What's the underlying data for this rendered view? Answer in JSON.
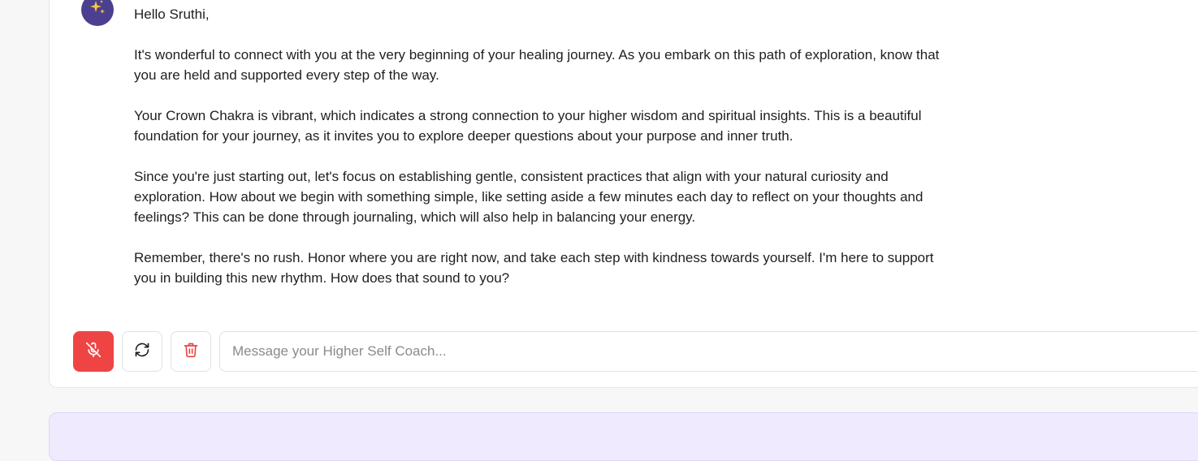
{
  "chat": {
    "avatar_icon": "sparkles-icon",
    "greeting": "Hello Sruthi,",
    "paragraphs": [
      "It's wonderful to connect with you at the very beginning of your healing journey. As you embark on this path of exploration, know that you are held and supported every step of the way.",
      "Your Crown Chakra is vibrant, which indicates a strong connection to your higher wisdom and spiritual insights. This is a beautiful foundation for your journey, as it invites you to explore deeper questions about your purpose and inner truth.",
      "Since you're just starting out, let's focus on establishing gentle, consistent practices that align with your natural curiosity and exploration. How about we begin with something simple, like setting aside a few minutes each day to reflect on your thoughts and feelings? This can be done through journaling, which will also help in balancing your energy.",
      "Remember, there's no rush. Honor where you are right now, and take each step with kindness towards yourself. I'm here to support you in building this new rhythm. How does that sound to you?"
    ]
  },
  "composer": {
    "mic_icon": "mic-off-icon",
    "refresh_icon": "refresh-icon",
    "trash_icon": "trash-icon",
    "input_value": "",
    "input_placeholder": "Message your Higher Self Coach..."
  },
  "colors": {
    "avatar_bg": "#4b3f8f",
    "mic_button": "#ef4444",
    "trash_icon": "#ef4444",
    "bottom_panel": "#efeafd"
  }
}
